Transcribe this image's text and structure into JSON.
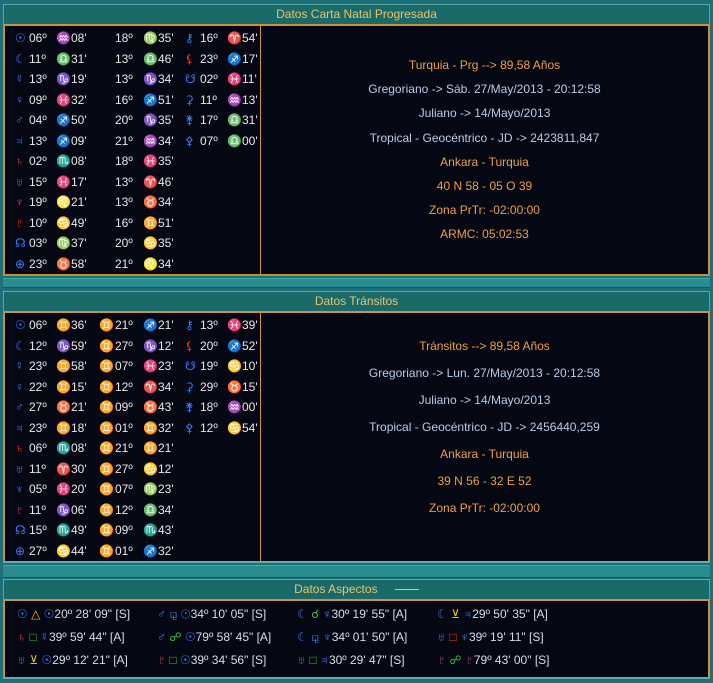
{
  "natal": {
    "title": "Datos Carta Natal Progresada",
    "col1": [
      {
        "g": "☉",
        "gc": "b",
        "d": "06º",
        "s": "♒",
        "m": "08'"
      },
      {
        "g": "☾",
        "gc": "b",
        "d": "11º",
        "s": "♎",
        "m": "31'"
      },
      {
        "g": "☿",
        "gc": "b",
        "d": "13º",
        "s": "♑",
        "m": "19'"
      },
      {
        "g": "♀",
        "gc": "b",
        "d": "09º",
        "s": "♓",
        "m": "32'"
      },
      {
        "g": "♂",
        "gc": "b",
        "d": "04º",
        "s": "♐",
        "m": "50'"
      },
      {
        "g": "♃",
        "gc": "b",
        "d": "13º",
        "s": "♐",
        "m": "09'"
      },
      {
        "g": "♄",
        "gc": "r",
        "d": "02º",
        "s": "♏",
        "m": "08'"
      },
      {
        "g": "♅",
        "gc": "b",
        "d": "15º",
        "s": "♓",
        "m": "17'"
      },
      {
        "g": "♆",
        "gc": "r",
        "d": "19º",
        "s": "♌",
        "m": "21'"
      },
      {
        "g": "♇",
        "gc": "r",
        "d": "10º",
        "s": "♋",
        "m": "49'"
      },
      {
        "g": "☊",
        "gc": "b",
        "d": "03º",
        "s": "♍",
        "m": "37'"
      },
      {
        "g": "⊕",
        "gc": "b",
        "d": "23º",
        "s": "♉",
        "m": "58'"
      }
    ],
    "col2": [
      {
        "d": "18º",
        "s": "♍",
        "m": "35'"
      },
      {
        "d": "13º",
        "s": "♎",
        "m": "46'"
      },
      {
        "d": "13º",
        "s": "♑",
        "m": "34'"
      },
      {
        "d": "16º",
        "s": "♐",
        "m": "51'"
      },
      {
        "d": "20º",
        "s": "♑",
        "m": "35'"
      },
      {
        "d": "21º",
        "s": "♒",
        "m": "34'"
      },
      {
        "d": "18º",
        "s": "♓",
        "m": "35'"
      },
      {
        "d": "13º",
        "s": "♈",
        "m": "46'"
      },
      {
        "d": "13º",
        "s": "♉",
        "m": "34'"
      },
      {
        "d": "16º",
        "s": "♊",
        "m": "51'"
      },
      {
        "d": "20º",
        "s": "♋",
        "m": "35'"
      },
      {
        "d": "21º",
        "s": "♌",
        "m": "34'"
      }
    ],
    "col3": [
      {
        "g": "⚷",
        "gc": "b",
        "d": "16º",
        "s": "♈",
        "m": "54'"
      },
      {
        "g": "⚸",
        "gc": "r",
        "d": "23º",
        "s": "♐",
        "m": "17'"
      },
      {
        "g": "☋",
        "gc": "b",
        "d": "02º",
        "s": "♓",
        "m": "11'"
      },
      {
        "g": "⚳",
        "gc": "b",
        "d": "11º",
        "s": "♒",
        "m": "13'"
      },
      {
        "g": "⚵",
        "gc": "b",
        "d": "17º",
        "s": "♎",
        "m": "31'"
      },
      {
        "g": "⚴",
        "gc": "b",
        "d": "07º",
        "s": "♎",
        "m": "00'"
      }
    ],
    "info": [
      {
        "t": "Turquia - Prg --> 89,58 Años",
        "c": "o"
      },
      {
        "t": "Gregoriano -> Sáb. 27/May/2013 - 20:12:58",
        "c": "b"
      },
      {
        "t": "Juliano -> 14/Mayo/2013",
        "c": "b"
      },
      {
        "t": "Tropical - Geocéntrico - JD -> 2423811,847",
        "c": "b"
      },
      {
        "t": "Ankara - Turquia",
        "c": "o"
      },
      {
        "t": "40 N 58 - 05 O 39",
        "c": "o"
      },
      {
        "t": "Zona PrTr: -02:00:00",
        "c": "o"
      },
      {
        "t": "ARMC: 05:02:53",
        "c": "o"
      }
    ]
  },
  "transits": {
    "title": "Datos Tránsitos",
    "col1": [
      {
        "g": "☉",
        "gc": "b",
        "d": "06º",
        "s": "♊",
        "m": "36'"
      },
      {
        "g": "☾",
        "gc": "b",
        "d": "12º",
        "s": "♑",
        "m": "59'"
      },
      {
        "g": "☿",
        "gc": "b",
        "d": "23º",
        "s": "♊",
        "m": "58'"
      },
      {
        "g": "♀",
        "gc": "b",
        "d": "22º",
        "s": "♊",
        "m": "15'"
      },
      {
        "g": "♂",
        "gc": "b",
        "d": "27º",
        "s": "♉",
        "m": "21'"
      },
      {
        "g": "♃",
        "gc": "b",
        "d": "23º",
        "s": "♊",
        "m": "18'"
      },
      {
        "g": "♄",
        "gc": "r",
        "d": "06º",
        "s": "♏",
        "m": "08'"
      },
      {
        "g": "♅",
        "gc": "b",
        "d": "11º",
        "s": "♈",
        "m": "30'"
      },
      {
        "g": "♆",
        "gc": "b",
        "d": "05º",
        "s": "♓",
        "m": "20'"
      },
      {
        "g": "♇",
        "gc": "r",
        "d": "11º",
        "s": "♑",
        "m": "06'"
      },
      {
        "g": "☊",
        "gc": "b",
        "d": "15º",
        "s": "♏",
        "m": "49'"
      },
      {
        "g": "⊕",
        "gc": "b",
        "d": "27º",
        "s": "♋",
        "m": "44'"
      }
    ],
    "col2": [
      {
        "d": "21º",
        "s": "♐",
        "m": "21'"
      },
      {
        "d": "27º",
        "s": "♑",
        "m": "12'"
      },
      {
        "d": "07º",
        "s": "♓",
        "m": "23'"
      },
      {
        "d": "12º",
        "s": "♈",
        "m": "34'"
      },
      {
        "d": "09º",
        "s": "♉",
        "m": "43'"
      },
      {
        "d": "01º",
        "s": "♊",
        "m": "32'"
      },
      {
        "d": "21º",
        "s": "♊",
        "m": "21'"
      },
      {
        "d": "27º",
        "s": "♋",
        "m": "12'"
      },
      {
        "d": "07º",
        "s": "♍",
        "m": "23'"
      },
      {
        "d": "12º",
        "s": "♎",
        "m": "34'"
      },
      {
        "d": "09º",
        "s": "♏",
        "m": "43'"
      },
      {
        "d": "01º",
        "s": "♐",
        "m": "32'"
      }
    ],
    "col2_prefix": "♊",
    "col3": [
      {
        "g": "⚷",
        "gc": "b",
        "d": "13º",
        "s": "♓",
        "m": "39'"
      },
      {
        "g": "⚸",
        "gc": "r",
        "d": "20º",
        "s": "♐",
        "m": "52'"
      },
      {
        "g": "☋",
        "gc": "b",
        "d": "19º",
        "s": "♋",
        "m": "10'"
      },
      {
        "g": "⚳",
        "gc": "b",
        "d": "29º",
        "s": "♉",
        "m": "15'"
      },
      {
        "g": "⚵",
        "gc": "b",
        "d": "18º",
        "s": "♒",
        "m": "00'"
      },
      {
        "g": "⚴",
        "gc": "b",
        "d": "12º",
        "s": "♋",
        "m": "54'"
      }
    ],
    "info": [
      {
        "t": "Tránsitos --> 89,58 Años",
        "c": "o"
      },
      {
        "t": "Gregoriano -> Lun. 27/May/2013 - 20:12:58",
        "c": "b"
      },
      {
        "t": "Juliano -> 14/Mayo/2013",
        "c": "b"
      },
      {
        "t": "Tropical - Geocéntrico - JD -> 2456440,259",
        "c": "b"
      },
      {
        "t": "Ankara - Turquia",
        "c": "o"
      },
      {
        "t": "39 N 56 - 32 E 52",
        "c": "o"
      },
      {
        "t": "Zona PrTr: -02:00:00",
        "c": "o"
      }
    ]
  },
  "aspects": {
    "title": "Datos Aspectos",
    "rows": [
      [
        {
          "p1": "☉",
          "p1c": "b",
          "a": "△",
          "ac": "t",
          "p2": "☉",
          "p2c": "b",
          "v": "20º 28' 09\" [S]"
        },
        {
          "p1": "♂",
          "p1c": "b",
          "a": "⚼",
          "ac": "b",
          "p2": "☉",
          "p2c": "b",
          "v": "34º 10' 05\" [S]"
        },
        {
          "p1": "☾",
          "p1c": "b",
          "a": "☌",
          "ac": "g",
          "p2": "♆",
          "p2c": "b",
          "v": "30º 19' 55\" [A]"
        },
        {
          "p1": "☾",
          "p1c": "b",
          "a": "⊻",
          "ac": "t",
          "p2": "♃",
          "p2c": "b",
          "v": "29º 50' 35\" [A]"
        }
      ],
      [
        {
          "p1": "♄",
          "p1c": "r",
          "a": "□",
          "ac": "g",
          "p2": "☿",
          "p2c": "b",
          "v": "39º 59' 44\" [A]"
        },
        {
          "p1": "♂",
          "p1c": "b",
          "a": "☍",
          "ac": "g",
          "p2": "☉",
          "p2c": "b",
          "v": "79º 58' 45\" [A]"
        },
        {
          "p1": "☾",
          "p1c": "b",
          "a": "⚼",
          "ac": "b",
          "p2": "♆",
          "p2c": "b",
          "v": "34º 01' 50\" [A]"
        },
        {
          "p1": "♅",
          "p1c": "b",
          "a": "□",
          "ac": "r",
          "p2": "♆",
          "p2c": "b",
          "v": "39º 19' 11\" [S]"
        }
      ],
      [
        {
          "p1": "♅",
          "p1c": "b",
          "a": "⊻",
          "ac": "t",
          "p2": "☉",
          "p2c": "b",
          "v": "29º 12' 21\" [A]"
        },
        {
          "p1": "♇",
          "p1c": "r",
          "a": "□",
          "ac": "g",
          "p2": "☉",
          "p2c": "b",
          "v": "39º 34' 56\" [S]"
        },
        {
          "p1": "♅",
          "p1c": "b",
          "a": "□",
          "ac": "g",
          "p2": "♃",
          "p2c": "b",
          "v": "30º 29' 47\" [S]"
        },
        {
          "p1": "♇",
          "p1c": "r",
          "a": "☍",
          "ac": "g",
          "p2": "♇",
          "p2c": "r",
          "v": "79º 43' 00\" [S]"
        }
      ]
    ]
  }
}
